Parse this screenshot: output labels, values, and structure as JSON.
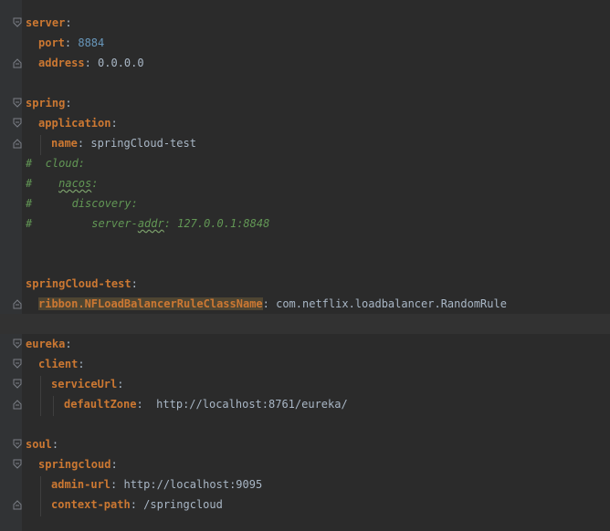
{
  "colors": {
    "background": "#2b2b2b",
    "key": "#cc7832",
    "value": "#a9b7c6",
    "number": "#6897bb",
    "comment": "#629755",
    "highlight": "#4e4532"
  },
  "lines": [
    {
      "key": "server",
      "colon": ":"
    },
    {
      "key": "port",
      "colon": ": ",
      "num": "8884"
    },
    {
      "key": "address",
      "colon": ": ",
      "value": "0.0.0.0"
    },
    {},
    {
      "key": "spring",
      "colon": ":"
    },
    {
      "key": "application",
      "colon": ":"
    },
    {
      "key": "name",
      "colon": ": ",
      "value": "springCloud-test"
    },
    {
      "comment_a": "#  cloud:"
    },
    {
      "comment_a": "#    ",
      "comment_sq": "nacos",
      "comment_b": ":"
    },
    {
      "comment_a": "#      discovery:"
    },
    {
      "comment_a": "#         server-",
      "comment_sq": "addr",
      "comment_b": ": 127.0.0.1:8848"
    },
    {},
    {},
    {
      "key": "springCloud-test",
      "colon": ":"
    },
    {
      "key": "ribbon.NFLoadBalancerRuleClassName",
      "colon": ": ",
      "value": "com.netflix.loadbalancer.RandomRule"
    },
    {},
    {
      "key": "eureka",
      "colon": ":"
    },
    {
      "key": "client",
      "colon": ":"
    },
    {
      "key": "serviceUrl",
      "colon": ":"
    },
    {
      "key": "defaultZone",
      "colon": ":  ",
      "value": "http://localhost:8761/eureka/"
    },
    {},
    {
      "key": "soul",
      "colon": ":"
    },
    {
      "key": "springcloud",
      "colon": ":"
    },
    {
      "key": "admin-url",
      "colon": ": ",
      "value": "http://localhost:9095"
    },
    {
      "key": "context-path",
      "colon": ": ",
      "value": "/springcloud"
    }
  ]
}
